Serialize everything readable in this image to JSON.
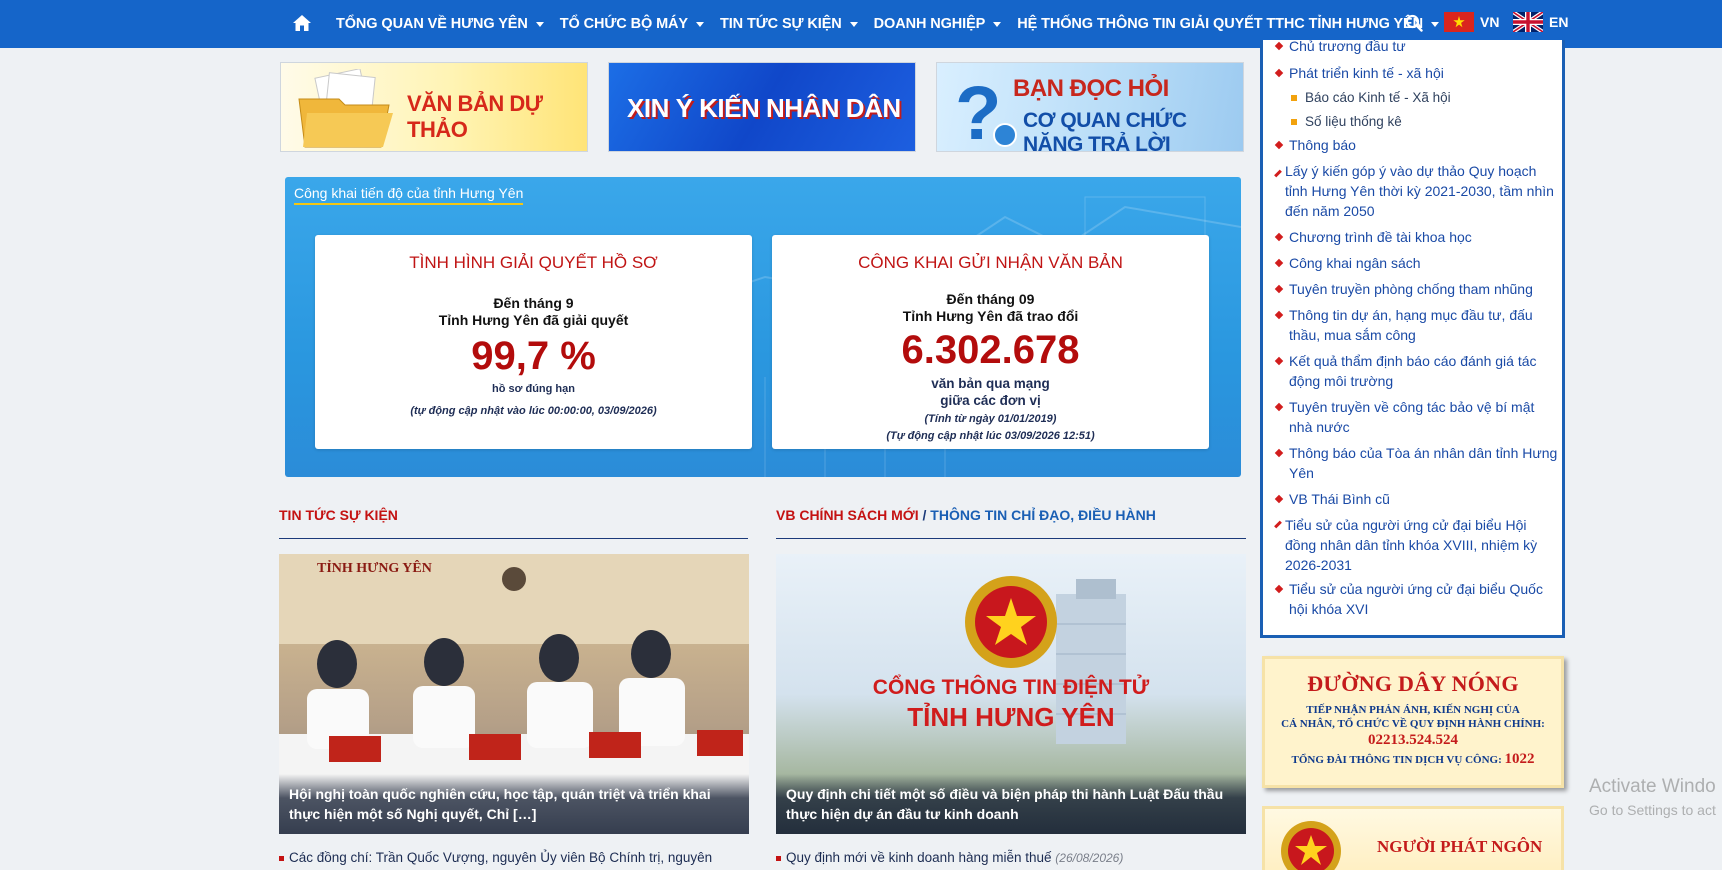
{
  "nav": {
    "home_icon": "home-icon",
    "items": [
      {
        "label": "TỔNG QUAN VỀ HƯNG YÊN"
      },
      {
        "label": "TỔ CHỨC BỘ MÁY"
      },
      {
        "label": "TIN TỨC SỰ KIỆN"
      },
      {
        "label": "DOANH NGHIỆP"
      },
      {
        "label": "HỆ THỐNG THÔNG TIN GIẢI QUYẾT TTHC TỈNH HƯNG YÊN"
      }
    ],
    "lang_vn": "VN",
    "lang_en": "EN",
    "color": "#1565c9"
  },
  "banners": {
    "draft": "VĂN BẢN DỰ THẢO",
    "opinion": "XIN Ý KIẾN NHÂN DÂN",
    "reader_l1": "BẠN ĐỌC HỎI",
    "reader_l2": "CƠ QUAN CHỨC NĂNG TRẢ LỜI"
  },
  "progress": {
    "title": "Công khai tiến độ của tỉnh Hưng Yên",
    "card1": {
      "title": "TÌNH HÌNH GIẢI QUYẾT HỒ SƠ",
      "line1": "Đến tháng 9",
      "line2": "Tỉnh Hưng Yên đã giải quyết",
      "value": "99,7 %",
      "unit": "hồ sơ đúng hạn",
      "note": "(tự động cập nhật vào lúc 00:00:00, 03/09/2026)"
    },
    "card2": {
      "title": "CÔNG KHAI GỬI NHẬN VĂN BẢN",
      "line1": "Đến tháng 09",
      "line2": "Tỉnh Hưng Yên đã trao đổi",
      "value": "6.302.678",
      "unit1": "văn bản qua mạng",
      "unit2": "giữa các đơn vị",
      "note1": "(Tính từ ngày 01/01/2019)",
      "note2": "(Tự động cập nhật lúc 03/09/2026 12:51)"
    }
  },
  "news": {
    "left_title": "TIN TỨC SỰ KIỆN",
    "left_caption": "Hội nghị toàn quốc nghiên cứu, học tập, quán triệt và triển khai thực hiện một số Nghị quyết, Chỉ […]",
    "left_photo_sign": "TỈNH HƯNG YÊN",
    "left_below": "Các đồng chí: Trần Quốc Vượng, nguyên Ủy viên Bộ Chính trị, nguyên",
    "right_title_a": "VB CHÍNH SÁCH MỚI",
    "right_title_sep": "/",
    "right_title_b": "THÔNG TIN CHỈ ĐẠO, ĐIỀU HÀNH",
    "right_photo_l1": "CỔNG THÔNG TIN ĐIỆN TỬ",
    "right_photo_l2": "TỈNH HƯNG YÊN",
    "right_caption": "Quy định chi tiết một số điều và biện pháp thi hành Luật Đấu thầu thực hiện dự án đầu tư kinh doanh",
    "right_below": "Quy định mới về kinh doanh hàng miễn thuế",
    "right_below_date": "(26/08/2026)"
  },
  "sidebar": {
    "items": [
      {
        "label": "Chủ trương đầu tư"
      },
      {
        "label": "Phát triển kinh tế - xã hội"
      },
      {
        "label": "Báo cáo Kinh tế - Xã hội"
      },
      {
        "label": "Số liệu thống kê"
      },
      {
        "label": "Thông báo"
      },
      {
        "label": "Lấy ý kiến góp ý vào dự thảo Quy hoạch tỉnh Hưng Yên thời kỳ 2021-2030, tầm nhìn đến năm 2050"
      },
      {
        "label": "Chương trình đề tài khoa học"
      },
      {
        "label": "Công khai ngân sách"
      },
      {
        "label": "Tuyên truyền phòng chống tham nhũng"
      },
      {
        "label": "Thông tin dự án, hạng mục đầu tư, đấu thầu, mua sắm công"
      },
      {
        "label": "Kết quả thẩm định báo cáo đánh giá tác động môi trường"
      },
      {
        "label": "Tuyên truyền về công tác bảo vệ bí mật nhà nước"
      },
      {
        "label": "Thông báo của Tòa án nhân dân tỉnh Hưng Yên"
      },
      {
        "label": "VB Thái Bình cũ"
      },
      {
        "label": "Tiểu sử của người ứng cử đại biểu Hội đồng nhân dân tỉnh khóa XVIII, nhiệm kỳ 2026-2031"
      },
      {
        "label": "Tiểu sử của người ứng cử đại biểu Quốc hội khóa XVI"
      }
    ]
  },
  "hotline": {
    "title": "ĐƯỜNG DÂY NÓNG",
    "line1": "TIẾP NHẬN PHẢN ÁNH, KIẾN NGHỊ CỦA",
    "line2": "CÁ NHÂN, TỔ CHỨC VỀ QUY ĐỊNH HÀNH CHÍNH:",
    "phone": "02213.524.524",
    "line3": "TỔNG ĐÀI THÔNG TIN DỊCH VỤ CÔNG:",
    "short": "1022"
  },
  "spokesperson": {
    "title": "NGƯỜI PHÁT NGÔN"
  },
  "os": {
    "watermark_l1": "Activate Windo",
    "watermark_l2": "Go to Settings to act"
  }
}
